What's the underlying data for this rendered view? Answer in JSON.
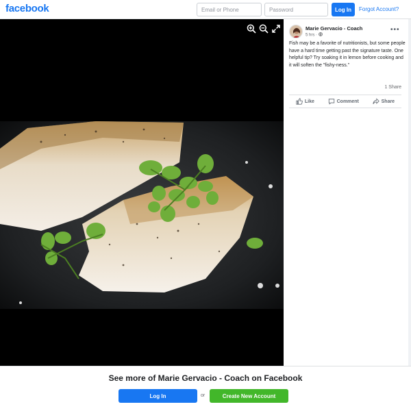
{
  "header": {
    "logo": "facebook",
    "email_placeholder": "Email or Phone",
    "password_placeholder": "Password",
    "login_label": "Log In",
    "forgot_label": "Forgot Account?"
  },
  "post": {
    "author": "Marie Gervacio - Coach",
    "time": "5 hrs · ",
    "text": "Fish may be a favorite of nutritionists, but some people have a hard time getting past the signature taste. One helpful tip? Try soaking it in lemon before cooking and it will soften the \"fishy-ness.\"",
    "shares": "1 Share",
    "actions": {
      "like": "Like",
      "comment": "Comment",
      "share": "Share"
    }
  },
  "banner": {
    "title": "See more of Marie Gervacio - Coach on Facebook",
    "login_label": "Log In",
    "or": "or",
    "create_label": "Create New Account"
  },
  "colors": {
    "brand": "#1877f2",
    "create_green": "#42b72a",
    "viewer_bg": "#000000"
  },
  "icons": [
    "zoom-in-icon",
    "zoom-out-icon",
    "fullscreen-icon",
    "globe-icon",
    "more-icon",
    "like-icon",
    "comment-icon",
    "share-icon"
  ]
}
